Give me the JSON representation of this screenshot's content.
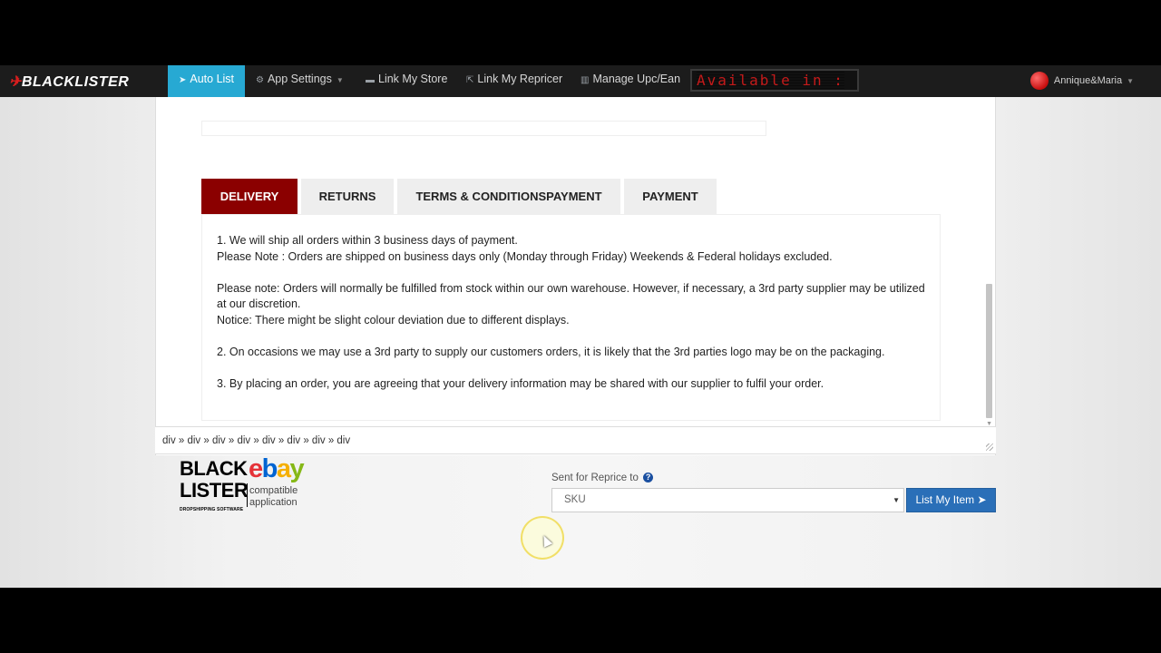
{
  "navbar": {
    "logo_prefix": "",
    "logo_text": "BLACKLISTER",
    "items": [
      {
        "label": "Auto List",
        "icon": "rocket-icon"
      },
      {
        "label": "App Settings",
        "icon": "gears-icon"
      },
      {
        "label": "Link My Store",
        "icon": "store-icon"
      },
      {
        "label": "Link My Repricer",
        "icon": "share-icon"
      },
      {
        "label": "Manage Upc/Ean",
        "icon": "barcode-icon"
      }
    ],
    "ticker_text": "Available in :",
    "user_name": "Annique&Maria"
  },
  "tabs": [
    "DELIVERY",
    "RETURNS",
    "TERMS & CONDITIONSPAYMENT",
    "PAYMENT"
  ],
  "content": {
    "p1": "1. We will ship all orders within 3 business days of payment.",
    "p2": "Please Note : Orders are shipped on business days only (Monday through Friday) Weekends & Federal holidays excluded.",
    "p3": "Please note: Orders will normally be fulfilled from stock within our own warehouse. However, if necessary, a 3rd party supplier may be utilized at our discretion.",
    "p4": "Notice: There might be slight colour deviation due to different displays.",
    "p5": "2. On occasions we may use a 3rd party to supply our customers orders, it is likely that the 3rd parties logo may be on the packaging.",
    "p6": "3. By placing an order, you are agreeing that your delivery information may be shared with our supplier to fulfil your order."
  },
  "statusbar": {
    "path": "div » div » div » div » div » div » div » div"
  },
  "brand": {
    "line1": "BLACK",
    "line2": "LISTER",
    "tagline": "DROPSHIPPING SOFTWARE",
    "ebay": [
      "e",
      "b",
      "a",
      "y"
    ],
    "compat1": "compatible",
    "compat2": "application"
  },
  "reprice": {
    "label": "Sent for Reprice to",
    "selected": "SKU",
    "button": "List My Item"
  }
}
